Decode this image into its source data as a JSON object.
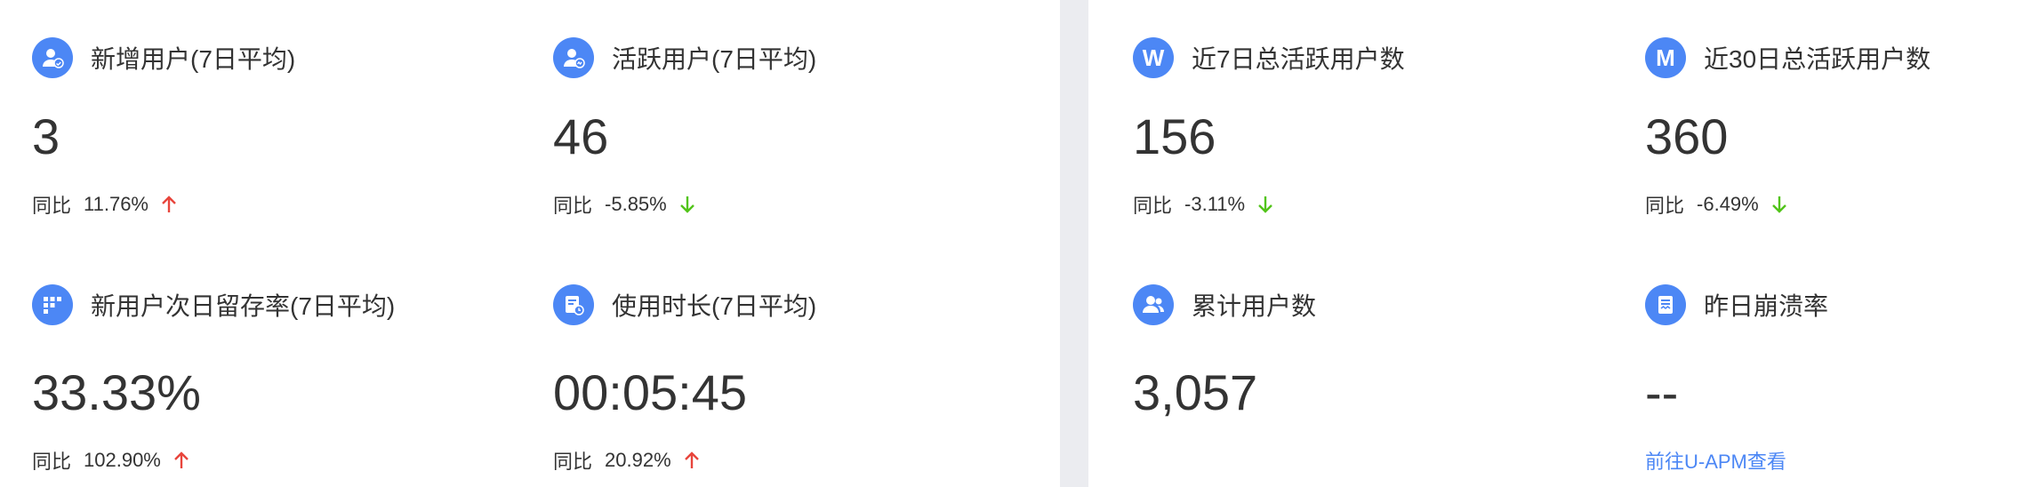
{
  "colors": {
    "accent": "#4c87f5",
    "up": "#e8453c",
    "down": "#52c41a",
    "divider": "#ebecf0"
  },
  "left_panel": {
    "cards": [
      {
        "icon": "user-add-icon",
        "title": "新增用户(7日平均)",
        "value": "3",
        "compare_label": "同比",
        "compare_pct": "11.76%",
        "trend": "up"
      },
      {
        "icon": "user-active-icon",
        "title": "活跃用户(7日平均)",
        "value": "46",
        "compare_label": "同比",
        "compare_pct": "-5.85%",
        "trend": "down"
      },
      {
        "icon": "grid-icon",
        "title": "新用户次日留存率(7日平均)",
        "value": "33.33%",
        "compare_label": "同比",
        "compare_pct": "102.90%",
        "trend": "up"
      },
      {
        "icon": "clock-document-icon",
        "title": "使用时长(7日平均)",
        "value": "00:05:45",
        "compare_label": "同比",
        "compare_pct": "20.92%",
        "trend": "up"
      }
    ]
  },
  "right_panel": {
    "cards": [
      {
        "icon": "w-letter-icon",
        "icon_letter": "W",
        "title": "近7日总活跃用户数",
        "value": "156",
        "compare_label": "同比",
        "compare_pct": "-3.11%",
        "trend": "down"
      },
      {
        "icon": "m-letter-icon",
        "icon_letter": "M",
        "title": "近30日总活跃用户数",
        "value": "360",
        "compare_label": "同比",
        "compare_pct": "-6.49%",
        "trend": "down"
      },
      {
        "icon": "users-icon",
        "title": "累计用户数",
        "value": "3,057"
      },
      {
        "icon": "crash-report-icon",
        "title": "昨日崩溃率",
        "value": "--",
        "link_label": "前往U-APM查看"
      }
    ]
  }
}
